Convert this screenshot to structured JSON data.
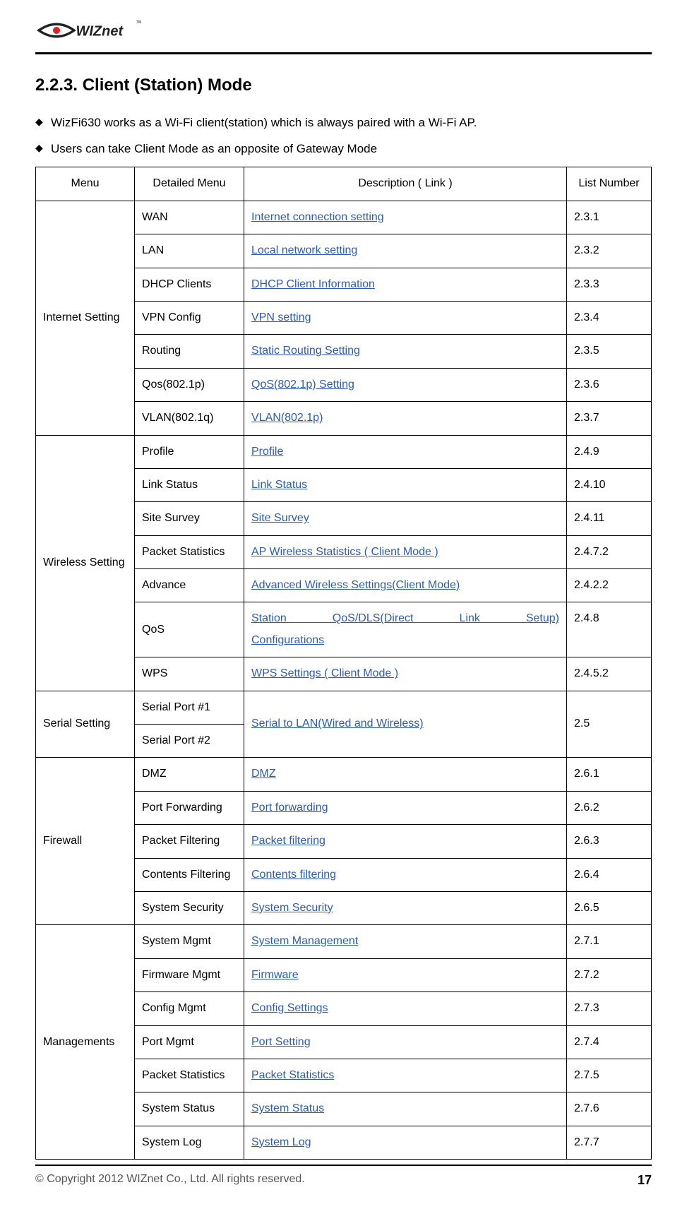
{
  "logo": {
    "name": "WIZnet",
    "tm": "TM"
  },
  "section": {
    "title": "2.2.3.  Client (Station) Mode"
  },
  "bullets": [
    "WizFi630 works as a Wi-Fi client(station) which is always paired with a Wi-Fi AP.",
    "Users can take Client Mode as an opposite of Gateway Mode"
  ],
  "table": {
    "headers": {
      "menu": "Menu",
      "detail": "Detailed Menu",
      "desc": "Description ( Link )",
      "list": "List Number"
    },
    "groups": [
      {
        "menu": "Internet Setting",
        "rows": [
          {
            "detail": "WAN",
            "desc": "Internet connection setting",
            "list": "2.3.1"
          },
          {
            "detail": "LAN",
            "desc": "Local network setting",
            "list": "2.3.2"
          },
          {
            "detail": "DHCP Clients",
            "desc": "DHCP Client Information",
            "list": "2.3.3"
          },
          {
            "detail": "VPN Config",
            "desc": "VPN setting",
            "list": "2.3.4"
          },
          {
            "detail": "Routing",
            "desc": "Static Routing Setting",
            "list": "2.3.5"
          },
          {
            "detail": "Qos(802.1p)",
            "desc": "QoS(802.1p) Setting",
            "list": "2.3.6"
          },
          {
            "detail": "VLAN(802.1q)",
            "desc": "VLAN(802.1p)",
            "list": "2.3.7"
          }
        ]
      },
      {
        "menu": "Wireless Setting",
        "rows": [
          {
            "detail": "Profile",
            "desc": "Profile",
            "list": "2.4.9"
          },
          {
            "detail": "Link Status",
            "desc": "Link Status",
            "list": "2.4.10"
          },
          {
            "detail": "Site Survey",
            "desc": "Site Survey",
            "list": "2.4.11"
          },
          {
            "detail": "Packet Statistics",
            "desc": "AP Wireless Statistics ( Client Mode )",
            "list": "2.4.7.2"
          },
          {
            "detail": "Advance",
            "desc": "Advanced Wireless Settings(Client Mode)",
            "list": "2.4.2.2"
          },
          {
            "detail": "QoS",
            "desc_line1": "Station QoS/DLS(Direct Link Setup)",
            "desc_line2": "Configurations",
            "list": "2.4.8",
            "justify": true
          },
          {
            "detail": "WPS",
            "desc": "WPS Settings ( Client Mode )",
            "list": "2.4.5.2"
          }
        ]
      },
      {
        "menu": "Serial Setting",
        "serial": true,
        "rows": [
          {
            "detail": "Serial Port #1"
          },
          {
            "detail": "Serial Port #2"
          }
        ],
        "shared_desc": "Serial to LAN(Wired and Wireless)",
        "shared_list": "2.5"
      },
      {
        "menu": "Firewall",
        "rows": [
          {
            "detail": "DMZ",
            "desc": "DMZ",
            "list": "2.6.1"
          },
          {
            "detail": "Port Forwarding",
            "desc": "Port forwarding",
            "list": "2.6.2"
          },
          {
            "detail": "Packet Filtering",
            "desc": "Packet filtering",
            "list": "2.6.3"
          },
          {
            "detail": "Contents Filtering",
            "desc": "Contents filtering",
            "list": "2.6.4"
          },
          {
            "detail": "System Security",
            "desc": "System Security",
            "list": "2.6.5"
          }
        ]
      },
      {
        "menu": "Managements",
        "rows": [
          {
            "detail": "System Mgmt",
            "desc": "System Management",
            "list": "2.7.1"
          },
          {
            "detail": "Firmware Mgmt",
            "desc": "Firmware",
            "list": "2.7.2"
          },
          {
            "detail": "Config Mgmt",
            "desc": "Config Settings",
            "list": "2.7.3"
          },
          {
            "detail": "Port Mgmt",
            "desc": "Port Setting",
            "list": "2.7.4"
          },
          {
            "detail": "Packet Statistics",
            "desc": "Packet Statistics",
            "list": "2.7.5"
          },
          {
            "detail": "System Status",
            "desc": "System Status",
            "list": "2.7.6"
          },
          {
            "detail": "System Log",
            "desc": "System Log",
            "list": "2.7.7"
          }
        ]
      }
    ]
  },
  "footer": {
    "copyright": "© Copyright 2012 WIZnet Co., Ltd. All rights reserved.",
    "page": "17"
  }
}
